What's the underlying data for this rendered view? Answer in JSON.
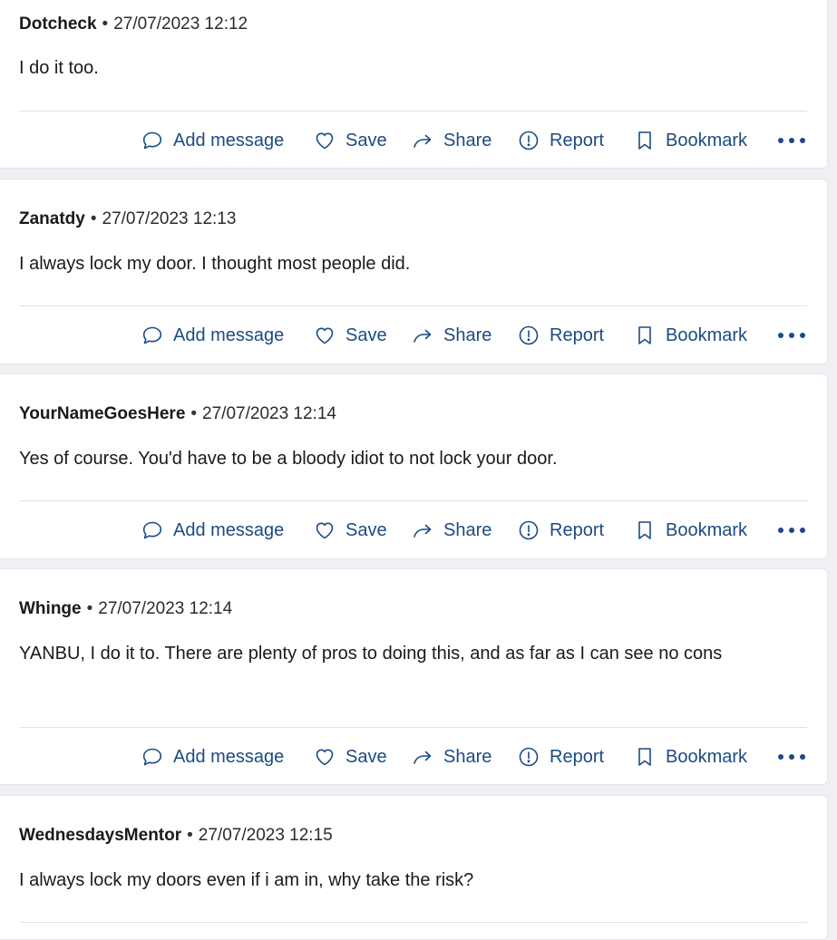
{
  "actions": {
    "add_message": "Add message",
    "save": "Save",
    "share": "Share",
    "report": "Report",
    "bookmark": "Bookmark"
  },
  "posts": [
    {
      "author": "Dotcheck",
      "separator": "•",
      "timestamp": "27/07/2023 12:12",
      "body": "I do it too."
    },
    {
      "author": "Zanatdy",
      "separator": "•",
      "timestamp": "27/07/2023 12:13",
      "body": "I always lock my door. I thought most people did."
    },
    {
      "author": "YourNameGoesHere",
      "separator": "•",
      "timestamp": "27/07/2023 12:14",
      "body": "Yes of course. You'd have to be a bloody idiot to not lock your door."
    },
    {
      "author": "Whinge",
      "separator": "•",
      "timestamp": "27/07/2023 12:14",
      "body": "YANBU, I do it to. There are plenty of pros to doing this, and as far as I can see no cons"
    },
    {
      "author": "WednesdaysMentor",
      "separator": "•",
      "timestamp": "27/07/2023 12:15",
      "body": "I always lock my doors even if i am in, why take the risk?"
    }
  ],
  "colors": {
    "action_blue": "#1c4b82",
    "background": "#eef0f3",
    "card": "#ffffff"
  },
  "icons": [
    "speech-bubble-icon",
    "heart-icon",
    "share-arrow-icon",
    "report-icon",
    "bookmark-icon",
    "more-icon"
  ]
}
